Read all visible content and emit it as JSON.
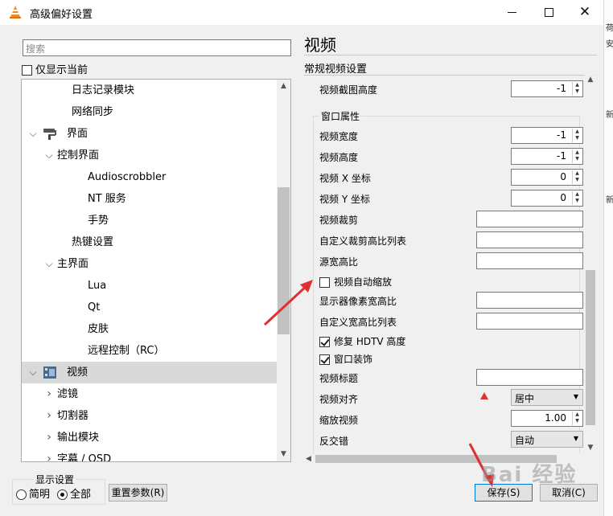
{
  "window": {
    "title": "高级偏好设置",
    "minimize_glyph": "—",
    "maximize_glyph": "☐",
    "close_glyph": "✕"
  },
  "right_strip": [
    "荷",
    "安",
    "新",
    "新"
  ],
  "left": {
    "search_placeholder": "搜索",
    "show_current_label": "仅显示当前",
    "tree": [
      {
        "label": "日志记录模块",
        "level": 1
      },
      {
        "label": "网络同步",
        "level": 1
      },
      {
        "label": "界面",
        "level": 0,
        "expanded": true,
        "icon": "paint-roller-icon"
      },
      {
        "label": "控制界面",
        "level": 1,
        "expanded": true
      },
      {
        "label": "Audioscrobbler",
        "level": 2
      },
      {
        "label": "NT 服务",
        "level": 2
      },
      {
        "label": "手势",
        "level": 2
      },
      {
        "label": "热键设置",
        "level": 1
      },
      {
        "label": "主界面",
        "level": 1,
        "expanded": true
      },
      {
        "label": "Lua",
        "level": 2
      },
      {
        "label": "Qt",
        "level": 2
      },
      {
        "label": "皮肤",
        "level": 2
      },
      {
        "label": "远程控制（RC）",
        "level": 2
      },
      {
        "label": "视频",
        "level": 0,
        "expanded": true,
        "selected": true,
        "icon": "film-icon"
      },
      {
        "label": "滤镜",
        "level": 1,
        "expanded": false
      },
      {
        "label": "切割器",
        "level": 1,
        "expanded": false
      },
      {
        "label": "输出模块",
        "level": 1,
        "expanded": false
      },
      {
        "label": "字幕 / OSD",
        "level": 1,
        "expanded": false
      }
    ]
  },
  "right": {
    "section_title": "视频",
    "general_label": "常规视频设置",
    "snapshot_height": {
      "label": "视频截图高度",
      "value": "-1"
    },
    "window_props_label": "窗口属性",
    "video_width": {
      "label": "视频宽度",
      "value": "-1"
    },
    "video_height": {
      "label": "视频高度",
      "value": "-1"
    },
    "video_x": {
      "label": "视频 X 坐标",
      "value": "0"
    },
    "video_y": {
      "label": "视频 Y 坐标",
      "value": "0"
    },
    "video_crop": {
      "label": "视频裁剪",
      "value": ""
    },
    "custom_crop_list": {
      "label": "自定义裁剪高比列表",
      "value": ""
    },
    "source_aspect": {
      "label": "源宽高比",
      "value": ""
    },
    "auto_scale": {
      "label": "视频自动缩放",
      "checked": false
    },
    "monitor_pixel_aspect": {
      "label": "显示器像素宽高比",
      "value": ""
    },
    "custom_aspect_list": {
      "label": "自定义宽高比列表",
      "value": ""
    },
    "fix_hdtv": {
      "label": "修复 HDTV 高度",
      "checked": true
    },
    "window_deco": {
      "label": "窗口装饰",
      "checked": true
    },
    "video_title": {
      "label": "视频标题",
      "value": ""
    },
    "video_align": {
      "label": "视频对齐",
      "value": "居中"
    },
    "zoom_video": {
      "label": "缩放视频",
      "value": "1.00"
    },
    "deinterlace": {
      "label": "反交错",
      "value": "自动"
    }
  },
  "bottom": {
    "display_settings_label": "显示设置",
    "simple_label": "简明",
    "all_label": "全部",
    "selected_mode": "all",
    "reset_label": "重置参数(R)",
    "save_label": "保存(S)",
    "cancel_label": "取消(C)"
  },
  "watermark": "Bai 经验",
  "colors": {
    "annotation_red": "#e03030",
    "selection": "#d9d9d9",
    "primary_border": "#0078d7"
  }
}
